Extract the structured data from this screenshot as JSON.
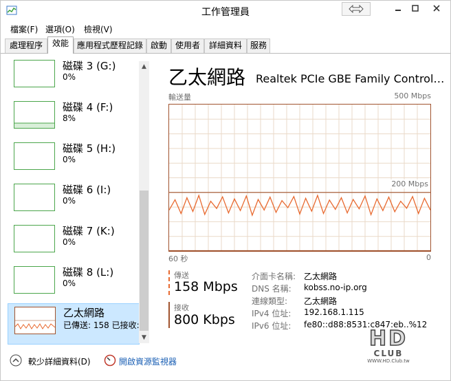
{
  "window": {
    "title": "工作管理員"
  },
  "menu": [
    "檔案(F)",
    "選項(O)",
    "檢視(V)"
  ],
  "tabs": [
    "處理程序",
    "效能",
    "應用程式歷程記錄",
    "啟動",
    "使用者",
    "詳細資料",
    "服務"
  ],
  "active_tab": 1,
  "sidebar": {
    "items": [
      {
        "name": "磁碟 3 (G:)",
        "value": "0%"
      },
      {
        "name": "磁碟 4 (F:)",
        "value": "8%"
      },
      {
        "name": "磁碟 5 (H:)",
        "value": "0%"
      },
      {
        "name": "磁碟 6 (I:)",
        "value": "0%"
      },
      {
        "name": "磁碟 7 (K:)",
        "value": "0%"
      },
      {
        "name": "磁碟 8 (L:)",
        "value": "0%"
      },
      {
        "name": "乙太網路",
        "value": "已傳送: 158 已接收:"
      }
    ]
  },
  "panel": {
    "title": "乙太網路",
    "adapter": "Realtek PCIe GBE Family Control…",
    "graph_label": "輸送量",
    "graph_max": "500 Mbps",
    "graph_mid": "200 Mbps",
    "x_left": "60 秒",
    "x_right": "0",
    "send_label": "傳送",
    "send_value": "158 Mbps",
    "recv_label": "接收",
    "recv_value": "800 Kbps",
    "details": [
      {
        "k": "介面卡名稱:",
        "v": "乙太網路"
      },
      {
        "k": "DNS 名稱:",
        "v": "kobss.no-ip.org"
      },
      {
        "k": "連線類型:",
        "v": "乙太網路"
      },
      {
        "k": "IPv4 位址:",
        "v": "192.168.1.115"
      },
      {
        "k": "IPv6 位址:",
        "v": "fe80::d88:8531:c847:eb..%12"
      }
    ]
  },
  "footer": {
    "less_details": "較少詳細資料(D)",
    "resource_monitor": "開啟資源監視器"
  },
  "watermark": {
    "line1": "HD",
    "line2": "CLUB",
    "line3": "WWW.HD.Club.tw"
  },
  "chart_data": {
    "type": "line",
    "title": "輸送量",
    "ylim": [
      0,
      500
    ],
    "series": [
      {
        "name": "傳送",
        "values": [
          140,
          175,
          128,
          182,
          135,
          190,
          125,
          170,
          145,
          185,
          130,
          178,
          138,
          188,
          122,
          176,
          140,
          184,
          132,
          172,
          148,
          186,
          126,
          180,
          136,
          190,
          128,
          174,
          142,
          182,
          130,
          176,
          144,
          188,
          124,
          178,
          138,
          184,
          134,
          170,
          146,
          186,
          128,
          180,
          140
        ]
      },
      {
        "name": "接收",
        "values": [
          1,
          1,
          1,
          1,
          1,
          1,
          1,
          1,
          1,
          1,
          1,
          1,
          1,
          1,
          1,
          1,
          1,
          1,
          1,
          1,
          1,
          1,
          1,
          1,
          1,
          1,
          1,
          1,
          1,
          1,
          1,
          1,
          1,
          1,
          1,
          1,
          1,
          1,
          1,
          1,
          1,
          1,
          1,
          1,
          1
        ]
      }
    ],
    "grid": true,
    "colors": {
      "line": "#e8692f",
      "border": "#a0522d",
      "grid": "#ead9c8",
      "thumb": "#4aa54a"
    }
  }
}
